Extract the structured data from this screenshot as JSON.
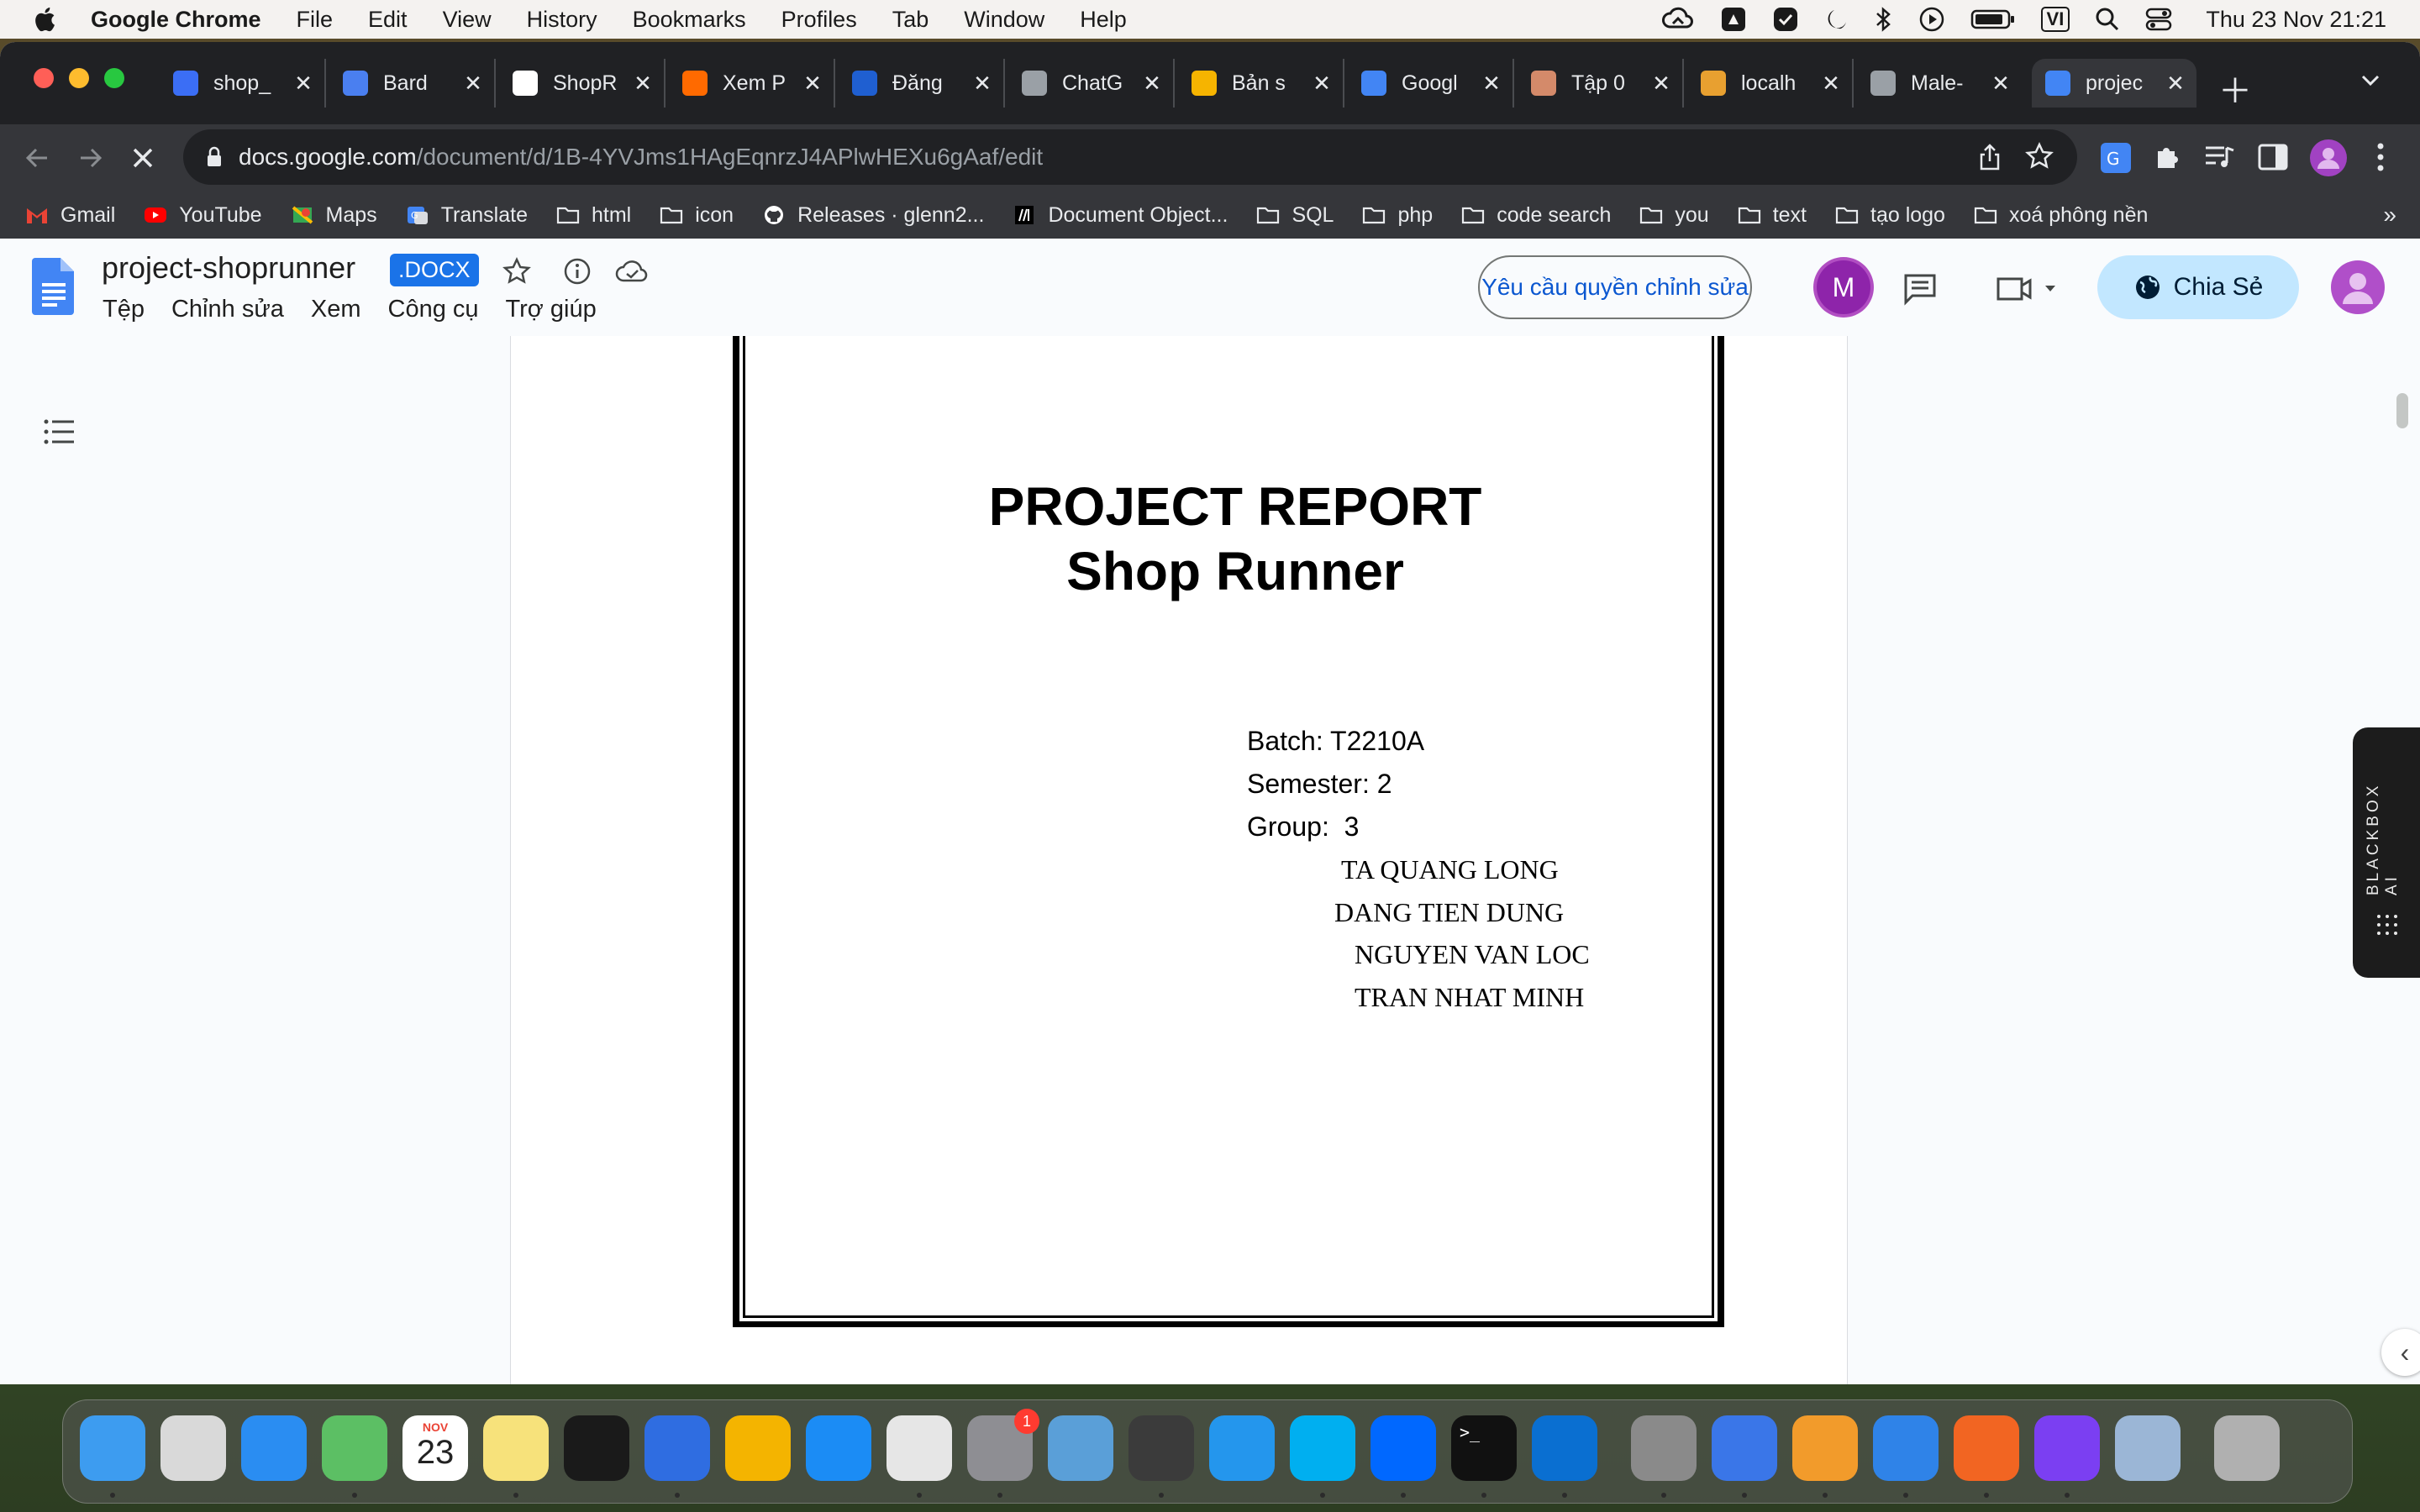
{
  "menubar": {
    "app": "Google Chrome",
    "items": [
      "File",
      "Edit",
      "View",
      "History",
      "Bookmarks",
      "Profiles",
      "Tab",
      "Window",
      "Help"
    ],
    "input_source": "VI",
    "clock": "Thu 23 Nov  21:21"
  },
  "tabs": [
    {
      "label": "shop_",
      "fav_color": "#3b6ef5"
    },
    {
      "label": "Bard",
      "fav_color": "#4a7ff0"
    },
    {
      "label": "ShopR",
      "fav_color": "#ffffff"
    },
    {
      "label": "Xem P",
      "fav_color": "#ff6a00"
    },
    {
      "label": "Đăng",
      "fav_color": "#1f5fd1"
    },
    {
      "label": "ChatG",
      "fav_color": "#9aa0a6"
    },
    {
      "label": "Bản s",
      "fav_color": "#f6b400"
    },
    {
      "label": "Googl",
      "fav_color": "#4285f4"
    },
    {
      "label": "Tập 0",
      "fav_color": "#d48a6a"
    },
    {
      "label": "localh",
      "fav_color": "#e8a030"
    },
    {
      "label": "Male-",
      "fav_color": "#9aa0a6"
    },
    {
      "label": "projec",
      "fav_color": "#4285f4"
    }
  ],
  "address": {
    "host": "docs.google.com",
    "path": "/document/d/1B-4YVJms1HAgEqnrzJ4APlwHEXu6gAaf/edit"
  },
  "bookmarks": [
    {
      "label": "Gmail",
      "icon": "gmail-icon",
      "color": "#ea4335"
    },
    {
      "label": "YouTube",
      "icon": "youtube-icon",
      "color": "#ff0000"
    },
    {
      "label": "Maps",
      "icon": "maps-icon",
      "color": "#34a853"
    },
    {
      "label": "Translate",
      "icon": "translate-icon",
      "color": "#4285f4"
    },
    {
      "label": "html",
      "icon": "folder-icon",
      "color": ""
    },
    {
      "label": "icon",
      "icon": "folder-icon",
      "color": ""
    },
    {
      "label": "Releases · glenn2...",
      "icon": "github-icon",
      "color": "#ffffff"
    },
    {
      "label": "Document Object...",
      "icon": "mdn-icon",
      "color": "#000000"
    },
    {
      "label": "SQL",
      "icon": "folder-icon",
      "color": ""
    },
    {
      "label": "php",
      "icon": "folder-icon",
      "color": ""
    },
    {
      "label": "code search",
      "icon": "folder-icon",
      "color": ""
    },
    {
      "label": "you",
      "icon": "folder-icon",
      "color": ""
    },
    {
      "label": "text",
      "icon": "folder-icon",
      "color": ""
    },
    {
      "label": "tạo logo",
      "icon": "folder-icon",
      "color": ""
    },
    {
      "label": "xoá phông nền",
      "icon": "folder-icon",
      "color": ""
    }
  ],
  "docs": {
    "title": "project-shoprunner",
    "badge": ".DOCX",
    "menu": [
      "Tệp",
      "Chỉnh sửa",
      "Xem",
      "Công cụ",
      "Trợ giúp"
    ],
    "request_edit": "Yêu cầu quyền chỉnh sửa",
    "avatar_letter": "M",
    "share": "Chia Sẻ"
  },
  "document": {
    "title": "PROJECT REPORT",
    "subtitle": "Shop Runner",
    "batch": "Batch: T2210A",
    "semester": "Semester: 2",
    "group": "Group:  3",
    "members": [
      "TA QUANG LONG",
      "DANG TIEN DUNG",
      "NGUYEN VAN LOC",
      "TRAN NHAT MINH"
    ]
  },
  "extension_panel": "BLACKBOX AI",
  "dock": {
    "calendar_month": "NOV",
    "calendar_day": "23",
    "settings_badge": "1",
    "apps": [
      {
        "name": "finder",
        "color": "#3d9cf0"
      },
      {
        "name": "launchpad",
        "color": "#d9d9d9"
      },
      {
        "name": "safari",
        "color": "#2a8df2"
      },
      {
        "name": "maps",
        "color": "#5cbf64"
      },
      {
        "name": "calendar",
        "color": "#ffffff"
      },
      {
        "name": "notes",
        "color": "#f7e27b"
      },
      {
        "name": "activity-monitor",
        "color": "#1a1a1a"
      },
      {
        "name": "docs",
        "color": "#2f6de1"
      },
      {
        "name": "slides",
        "color": "#f4b400"
      },
      {
        "name": "app-store",
        "color": "#1b8cf5"
      },
      {
        "name": "chrome",
        "color": "#e6e6e6"
      },
      {
        "name": "system-settings",
        "color": "#8e8e93"
      },
      {
        "name": "db-tool",
        "color": "#5a9fd8"
      },
      {
        "name": "sublime-text",
        "color": "#3b3b3b"
      },
      {
        "name": "docker",
        "color": "#2496ed"
      },
      {
        "name": "skype",
        "color": "#00aff0"
      },
      {
        "name": "zalo",
        "color": "#0068ff"
      },
      {
        "name": "terminal",
        "color": "#111111"
      },
      {
        "name": "vscode",
        "color": "#0a6fd1"
      },
      {
        "name": "tableplus",
        "color": "#8a8a8a"
      },
      {
        "name": "xcode-like",
        "color": "#3a76e8"
      },
      {
        "name": "pages",
        "color": "#f29b2b"
      },
      {
        "name": "keynote",
        "color": "#2f83e8"
      },
      {
        "name": "sourcetree",
        "color": "#f26522"
      },
      {
        "name": "phpstorm",
        "color": "#7b3ff2"
      },
      {
        "name": "preview",
        "color": "#9bb6d6"
      },
      {
        "name": "trash",
        "color": "#b0b0b0"
      }
    ]
  }
}
